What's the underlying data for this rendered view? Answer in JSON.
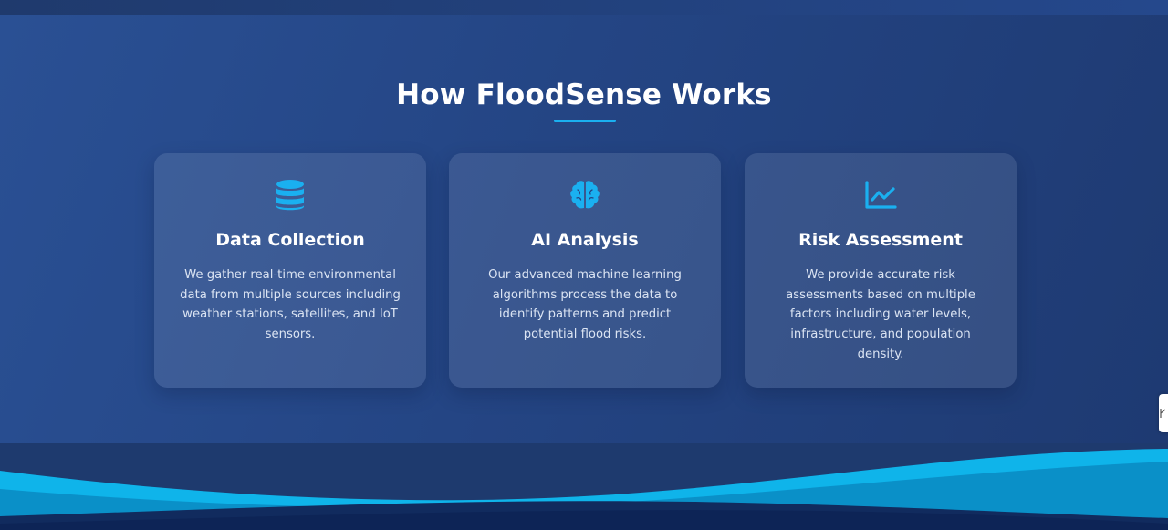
{
  "section": {
    "title": "How FloodSense Works"
  },
  "cards": [
    {
      "icon": "database-icon",
      "title": "Data Collection",
      "description": "We gather real-time environmental data from multiple sources including weather stations, satellites, and IoT sensors."
    },
    {
      "icon": "brain-icon",
      "title": "AI Analysis",
      "description": "Our advanced machine learning algorithms process the data to identify patterns and predict potential flood risks."
    },
    {
      "icon": "chart-line-icon",
      "title": "Risk Assessment",
      "description": "We provide accurate risk assessments based on multiple factors including water levels, infrastructure, and population density."
    }
  ],
  "colors": {
    "accent": "#1ab0f0",
    "background": "#244584",
    "card": "rgba(255,255,255,0.10)",
    "wave_light": "#0fb4ea",
    "wave_dark": "#0a72a8"
  }
}
